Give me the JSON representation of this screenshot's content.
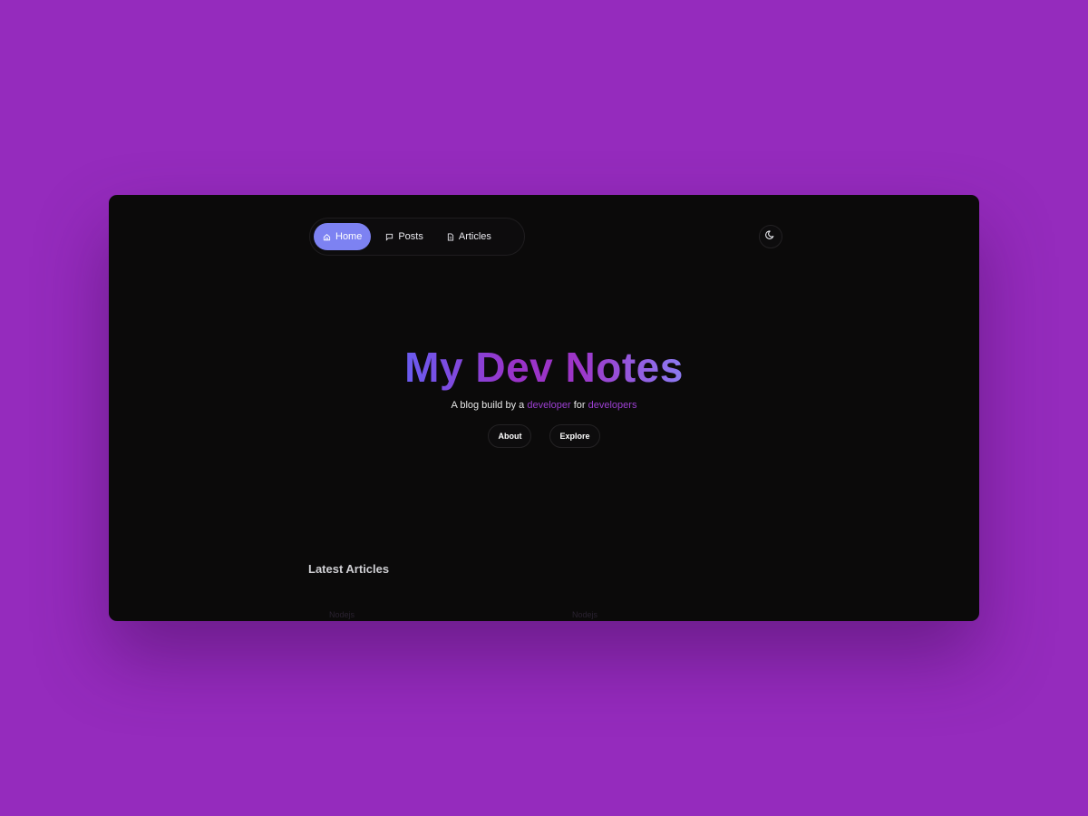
{
  "nav": {
    "items": [
      {
        "label": "Home",
        "icon": "home-icon",
        "active": true
      },
      {
        "label": "Posts",
        "icon": "chat-bubble-icon",
        "active": false
      },
      {
        "label": "Articles",
        "icon": "document-icon",
        "active": false
      }
    ],
    "theme_toggle_icon": "moon-icon"
  },
  "hero": {
    "title": "My Dev Notes",
    "tagline_prefix": "A blog build by a ",
    "tagline_highlight_1": "developer",
    "tagline_middle": " for ",
    "tagline_highlight_2": "developers",
    "buttons": {
      "about_label": "About",
      "explore_label": "Explore"
    }
  },
  "latest": {
    "title": "Latest Articles",
    "cards": [
      {
        "tag": "Nodejs"
      },
      {
        "tag": "Nodejs"
      }
    ]
  },
  "colors": {
    "background": "#952bbd",
    "window": "#0b0a0a",
    "accent": "#7d82f2",
    "highlight": "#9b3fd0"
  }
}
